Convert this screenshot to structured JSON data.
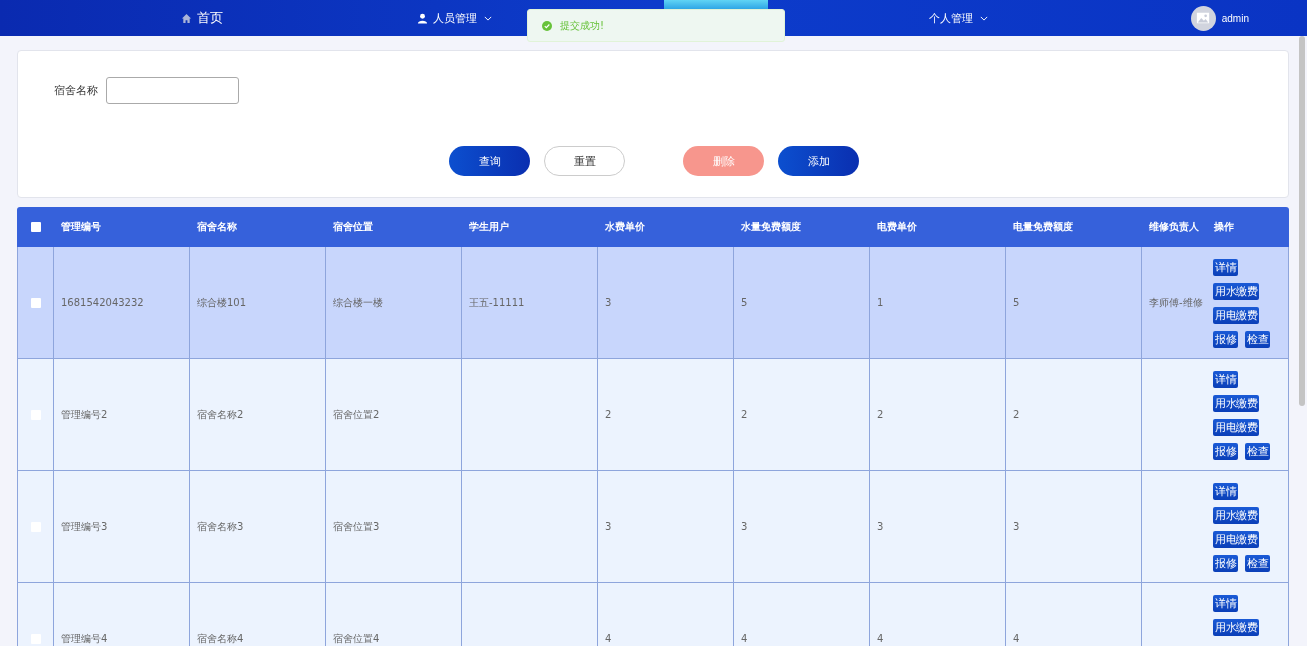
{
  "nav": {
    "items": [
      {
        "label": "首页",
        "kind": "home",
        "dropdown": false
      },
      {
        "label": "人员管理",
        "kind": "user",
        "dropdown": true
      },
      {
        "label": "个人管理",
        "kind": "plain",
        "dropdown": true
      }
    ],
    "user": {
      "name": "admin"
    }
  },
  "toast": {
    "kind": "success",
    "message": "提交成功!"
  },
  "search": {
    "label": "宿舍名称"
  },
  "buttons": [
    {
      "label": "查询",
      "kind": "primary"
    },
    {
      "label": "重置",
      "kind": "plain"
    },
    {
      "label": "删除",
      "kind": "danger"
    },
    {
      "label": "添加",
      "kind": "primary"
    }
  ],
  "table": {
    "all_checked": false,
    "columns": [
      "管理编号",
      "宿舍名称",
      "宿舍位置",
      "学生用户",
      "水费单价",
      "水量免费额度",
      "电费单价",
      "电量免费额度",
      "维修负责人",
      "操作"
    ],
    "rows": [
      {
        "selected": true,
        "checked": false,
        "cells": [
          "1681542043232",
          "综合楼101",
          "综合楼一楼",
          "王五-11111",
          "3",
          "5",
          "1",
          "5",
          "李师傅-维修"
        ],
        "actions": [
          "详情",
          "用水缴费",
          "用电缴费",
          "报修",
          "检查"
        ]
      },
      {
        "selected": false,
        "checked": false,
        "cells": [
          "管理编号2",
          "宿舍名称2",
          "宿舍位置2",
          null,
          "2",
          "2",
          "2",
          "2",
          null
        ],
        "actions": [
          "详情",
          "用水缴费",
          "用电缴费",
          "报修",
          "检查"
        ]
      },
      {
        "selected": false,
        "checked": false,
        "cells": [
          "管理编号3",
          "宿舍名称3",
          "宿舍位置3",
          null,
          "3",
          "3",
          "3",
          "3",
          null
        ],
        "actions": [
          "详情",
          "用水缴费",
          "用电缴费",
          "报修",
          "检查"
        ]
      },
      {
        "selected": false,
        "checked": false,
        "cells": [
          "管理编号4",
          "宿舍名称4",
          "宿舍位置4",
          null,
          "4",
          "4",
          "4",
          "4",
          null
        ],
        "actions": [
          "详情",
          "用水缴费"
        ]
      }
    ]
  }
}
